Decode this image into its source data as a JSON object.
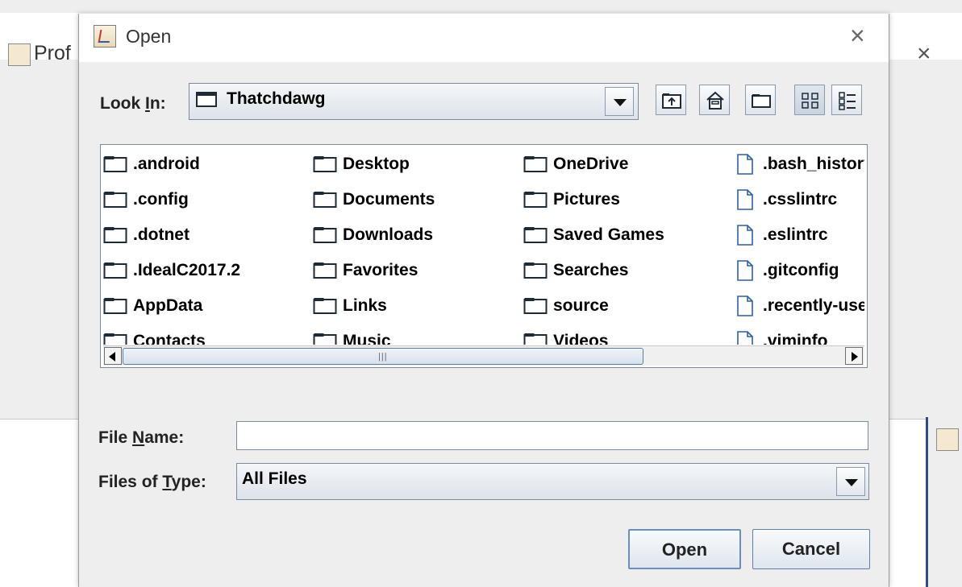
{
  "background_window": {
    "title": "Prof",
    "close_label": "×"
  },
  "dialog": {
    "title": "Open",
    "close_label": "×",
    "look_in_label_prefix": "Look ",
    "look_in_label_mnemonic": "I",
    "look_in_label_suffix": "n:",
    "look_in_value": "Thatchdawg",
    "toolbar_buttons": [
      "up-one-level",
      "home",
      "new-folder",
      "list-view",
      "details-view"
    ],
    "files": {
      "col1": [
        ".android",
        ".config",
        ".dotnet",
        ".IdealC2017.2",
        "AppData",
        "Contacts"
      ],
      "col2": [
        "Desktop",
        "Documents",
        "Downloads",
        "Favorites",
        "Links",
        "Music"
      ],
      "col3": [
        "OneDrive",
        "Pictures",
        "Saved Games",
        "Searches",
        "source",
        "Videos"
      ],
      "col4": [
        ".bash_history",
        ".csslintrc",
        ".eslintrc",
        ".gitconfig",
        ".recently-used",
        ".viminfo"
      ]
    },
    "file_name_label_prefix": "File ",
    "file_name_label_mnemonic": "N",
    "file_name_label_suffix": "ame:",
    "file_name_value": "",
    "files_of_type_label_prefix": "Files of ",
    "files_of_type_label_mnemonic": "T",
    "files_of_type_label_suffix": "ype:",
    "files_of_type_value": "All Files",
    "open_button": "Open",
    "cancel_button": "Cancel"
  }
}
